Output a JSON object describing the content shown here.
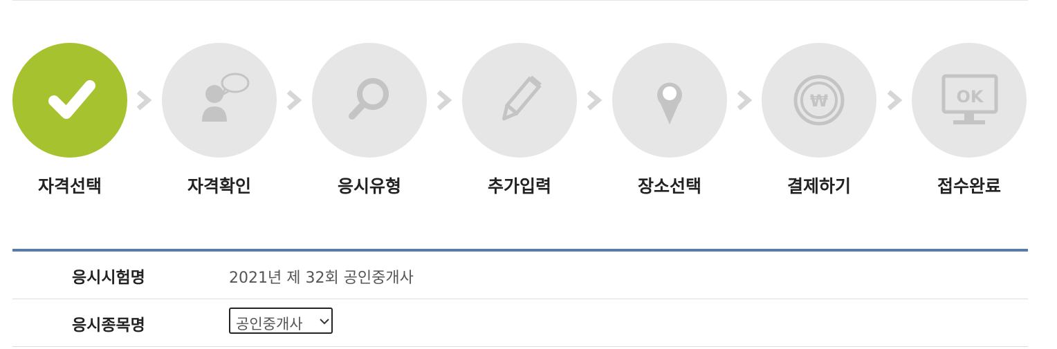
{
  "stepper": {
    "steps": [
      {
        "label": "자격선택",
        "icon": "check-icon",
        "state": "complete"
      },
      {
        "label": "자격확인",
        "icon": "person-speech-icon",
        "state": "pending"
      },
      {
        "label": "응시유형",
        "icon": "magnifier-icon",
        "state": "pending"
      },
      {
        "label": "추가입력",
        "icon": "pencil-icon",
        "state": "pending"
      },
      {
        "label": "장소선택",
        "icon": "location-pin-icon",
        "state": "pending"
      },
      {
        "label": "결제하기",
        "icon": "won-coin-icon",
        "state": "pending"
      },
      {
        "label": "접수완료",
        "icon": "monitor-ok-icon",
        "state": "pending"
      }
    ],
    "ok_text": "OK",
    "won_symbol": "₩"
  },
  "colors": {
    "active_step": "#a6c22f",
    "inactive_step": "#e6e6e6",
    "inactive_icon": "#c4c4c4",
    "table_top_border": "#5a7aa8"
  },
  "form": {
    "exam_name_label": "응시시험명",
    "exam_name_value": "2021년 제 32회 공인중개사",
    "subject_label": "응시종목명",
    "subject_selected": "공인중개사"
  }
}
